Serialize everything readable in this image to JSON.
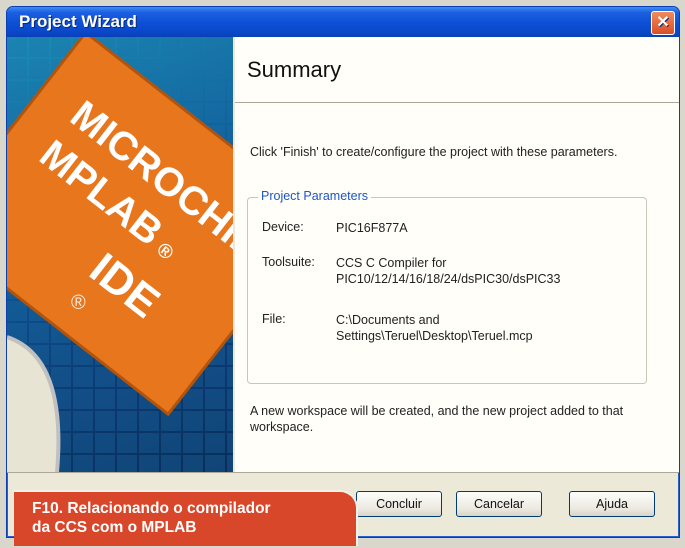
{
  "window": {
    "title": "Project Wizard",
    "close_label": "✕"
  },
  "side_art": {
    "brand_line1": "MICROCHIP",
    "brand_line2": "MPLAB",
    "brand_line3": "IDE",
    "registered": "®"
  },
  "summary": {
    "heading": "Summary",
    "intro": "Click 'Finish' to create/configure the project with these parameters.",
    "group_title": "Project Parameters",
    "params": [
      {
        "label": "Device:",
        "value": "PIC16F877A"
      },
      {
        "label": "Toolsuite:",
        "value": "CCS C Compiler for PIC10/12/14/16/18/24/dsPIC30/dsPIC33"
      },
      {
        "label": "File:",
        "value": "C:\\Documents and Settings\\Teruel\\Desktop\\Teruel.mcp"
      }
    ],
    "footer": "A new workspace will be created, and the new project added to that workspace."
  },
  "buttons": {
    "finish": "Concluir",
    "cancel": "Cancelar",
    "help": "Ajuda"
  },
  "caption": {
    "line1": "F10. Relacionando o compilador",
    "line2": "da CCS com o MPLAB"
  },
  "colors": {
    "titlebar": "#0c4fd6",
    "accent_orange": "#e8761c",
    "caption_bg": "#d9472b",
    "legend_blue": "#1f56c8"
  }
}
